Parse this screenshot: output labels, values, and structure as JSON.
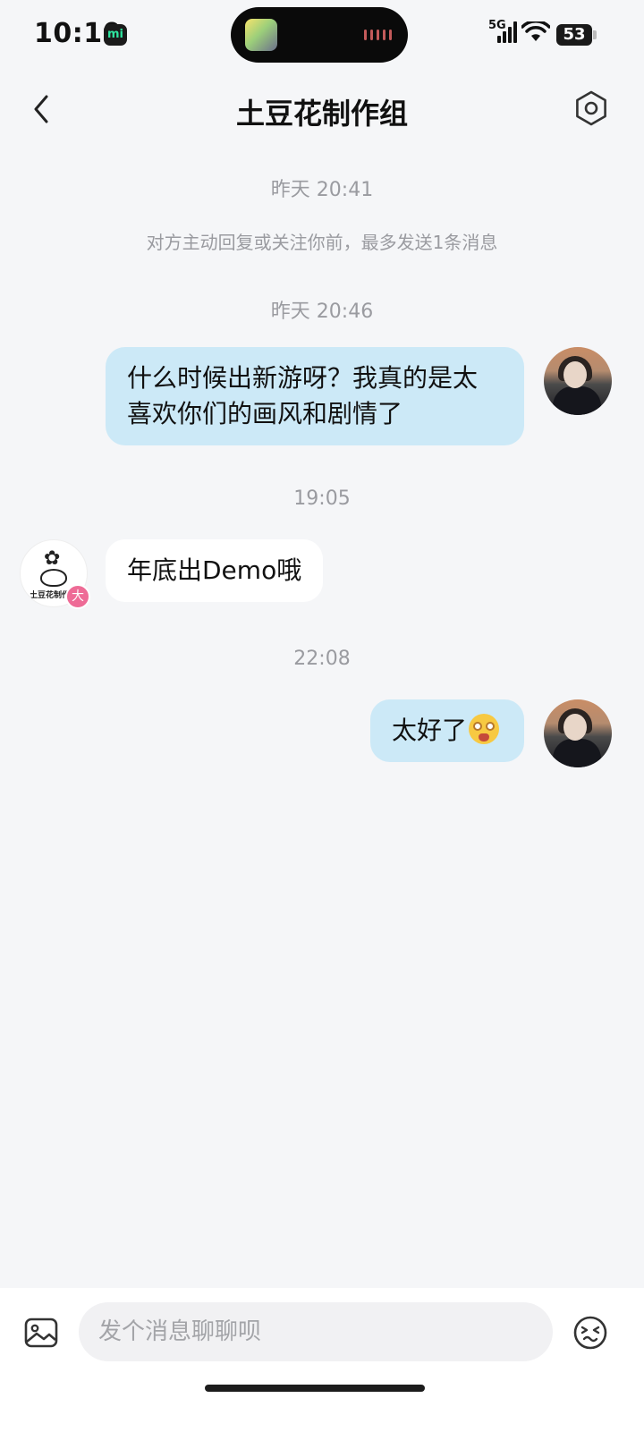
{
  "status_bar": {
    "time": "10:10",
    "mi_label": "mi",
    "network": "5G",
    "battery": "53"
  },
  "header": {
    "title": "土豆花制作组"
  },
  "chat": {
    "ts1": "昨天 20:41",
    "notice": "对方主动回复或关注你前，最多发送1条消息",
    "ts2": "昨天 20:46",
    "msg1_line1": "什么时候出新游呀？我真的是太",
    "msg1_line2": "喜欢你们的画风和剧情了",
    "ts3": "19:05",
    "msg2": "年底出Demo哦",
    "them_logo_text": "土豆花制作组",
    "them_badge": "大",
    "ts4": "22:08",
    "msg3": "太好了"
  },
  "input": {
    "placeholder": "发个消息聊聊呗"
  },
  "icons": {
    "back": "chevron-left-icon",
    "settings": "hexagon-settings-icon",
    "image": "image-icon",
    "emoji": "emoji-icon"
  }
}
